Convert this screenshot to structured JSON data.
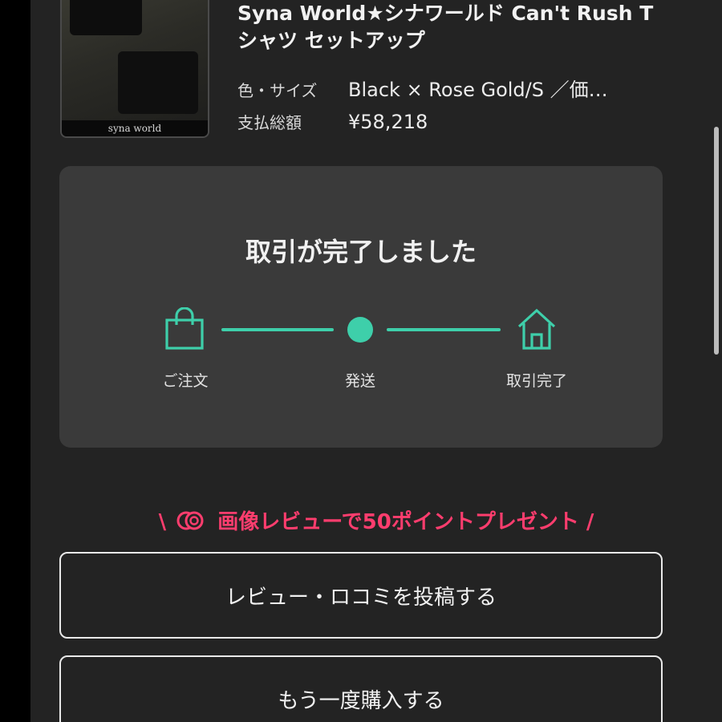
{
  "product": {
    "thumbnail_caption": "syna world",
    "title": "Syna World★シナワールド Can't Rush Tシャツ セットアップ",
    "variant_label": "色・サイズ",
    "variant_value": "Black × Rose Gold/S ／価…",
    "total_label": "支払総額",
    "total_value": "¥58,218"
  },
  "status": {
    "title": "取引が完了しました",
    "steps": [
      {
        "label": "ご注文",
        "icon": "shopping-bag-icon"
      },
      {
        "label": "発送",
        "icon": "dot-icon"
      },
      {
        "label": "取引完了",
        "icon": "house-icon"
      }
    ],
    "accent_color": "#3ecfaa"
  },
  "promo": {
    "prefix": "\\",
    "text": "画像レビューで50ポイントプレゼント",
    "suffix": "/",
    "color": "#ff3d6e"
  },
  "actions": {
    "review_label": "レビュー・ロコミを投稿する",
    "rebuy_label": "もう一度購入する"
  }
}
